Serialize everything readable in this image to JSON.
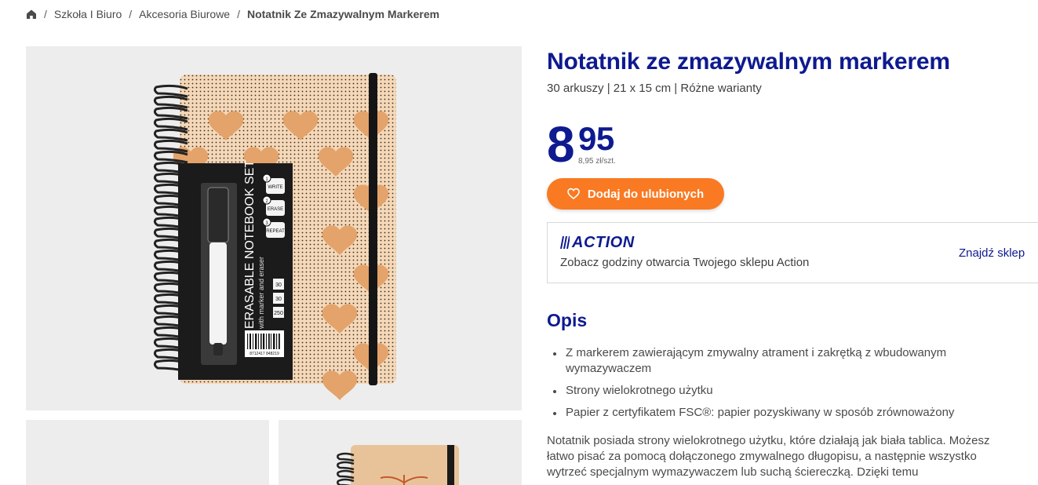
{
  "breadcrumb": {
    "items": [
      "Szkoła I Biuro",
      "Akcesoria Biurowe"
    ],
    "current": "Notatnik Ze Zmazywalnym Markerem",
    "separator": "/"
  },
  "gallery": {
    "main": {
      "set_title": "ERASABLE NOTEBOOK SET",
      "set_subtitle": "with marker and eraser",
      "steps": [
        "WRITE",
        "ERASE",
        "REPEAT"
      ],
      "step_numbers": [
        "1",
        "2",
        "3"
      ],
      "badges": [
        "30",
        "30",
        "250"
      ],
      "barcode_number": "8712417 848219"
    }
  },
  "product": {
    "title": "Notatnik ze zmazywalnym markerem",
    "subtitle": "30 arkuszy | 21 x 15 cm | Różne warianty",
    "price_int": "8",
    "price_dec": "95",
    "price_unit": "8,95 zł/szt.",
    "favorite_label": "Dodaj do ulubionych"
  },
  "store": {
    "logo_text": "ACTION",
    "hours_text": "Zobacz godziny otwarcia Twojego sklepu Action",
    "find_label": "Znajdź sklep"
  },
  "description": {
    "heading": "Opis",
    "bullets": [
      "Z markerem zawierającym zmywalny atrament i zakrętką z wbudowanym wymazywaczem",
      "Strony wielokrotnego użytku",
      "Papier z certyfikatem FSC®: papier pozyskiwany w sposób zrównoważony"
    ],
    "text": "Notatnik posiada strony wielokrotnego użytku, które działają jak biała tablica. Możesz łatwo pisać za pomocą dołączonego zmywalnego długopisu, a następnie wszystko wytrzeć specjalnym wymazywaczem lub suchą ściereczką. Dzięki temu"
  },
  "colors": {
    "brand_blue": "#0e1a8f",
    "accent_orange": "#f97a22",
    "cover_kraft": "#e0a468"
  }
}
